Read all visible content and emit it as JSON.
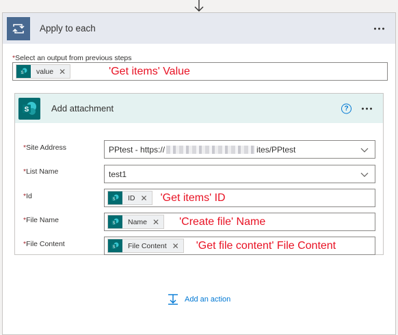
{
  "loop": {
    "title": "Apply to each",
    "select_label": "Select an output from previous steps",
    "value_token": "value",
    "annotation": "'Get items' Value"
  },
  "action": {
    "title": "Add attachment",
    "fields": {
      "site_address": {
        "label": "Site Address",
        "value_prefix": "PPtest - https://",
        "value_suffix": "ites/PPtest"
      },
      "list_name": {
        "label": "List Name",
        "value": "test1"
      },
      "id": {
        "label": "Id",
        "token": "ID",
        "annotation": "'Get items' ID"
      },
      "file_name": {
        "label": "File Name",
        "token": "Name",
        "annotation": "'Create file' Name"
      },
      "file_content": {
        "label": "File Content",
        "token": "File Content",
        "annotation": "'Get file content' File Content"
      }
    }
  },
  "add_action": {
    "label": "Add an action"
  },
  "colors": {
    "loop_accent": "#486991",
    "sharepoint": "#036c70",
    "annotation": "#e81123",
    "link": "#0078d4"
  },
  "icons": [
    "arrow-down-icon",
    "loop-icon",
    "more-icon",
    "sharepoint-icon",
    "help-icon",
    "close-icon",
    "chevron-down-icon",
    "add-action-icon"
  ]
}
